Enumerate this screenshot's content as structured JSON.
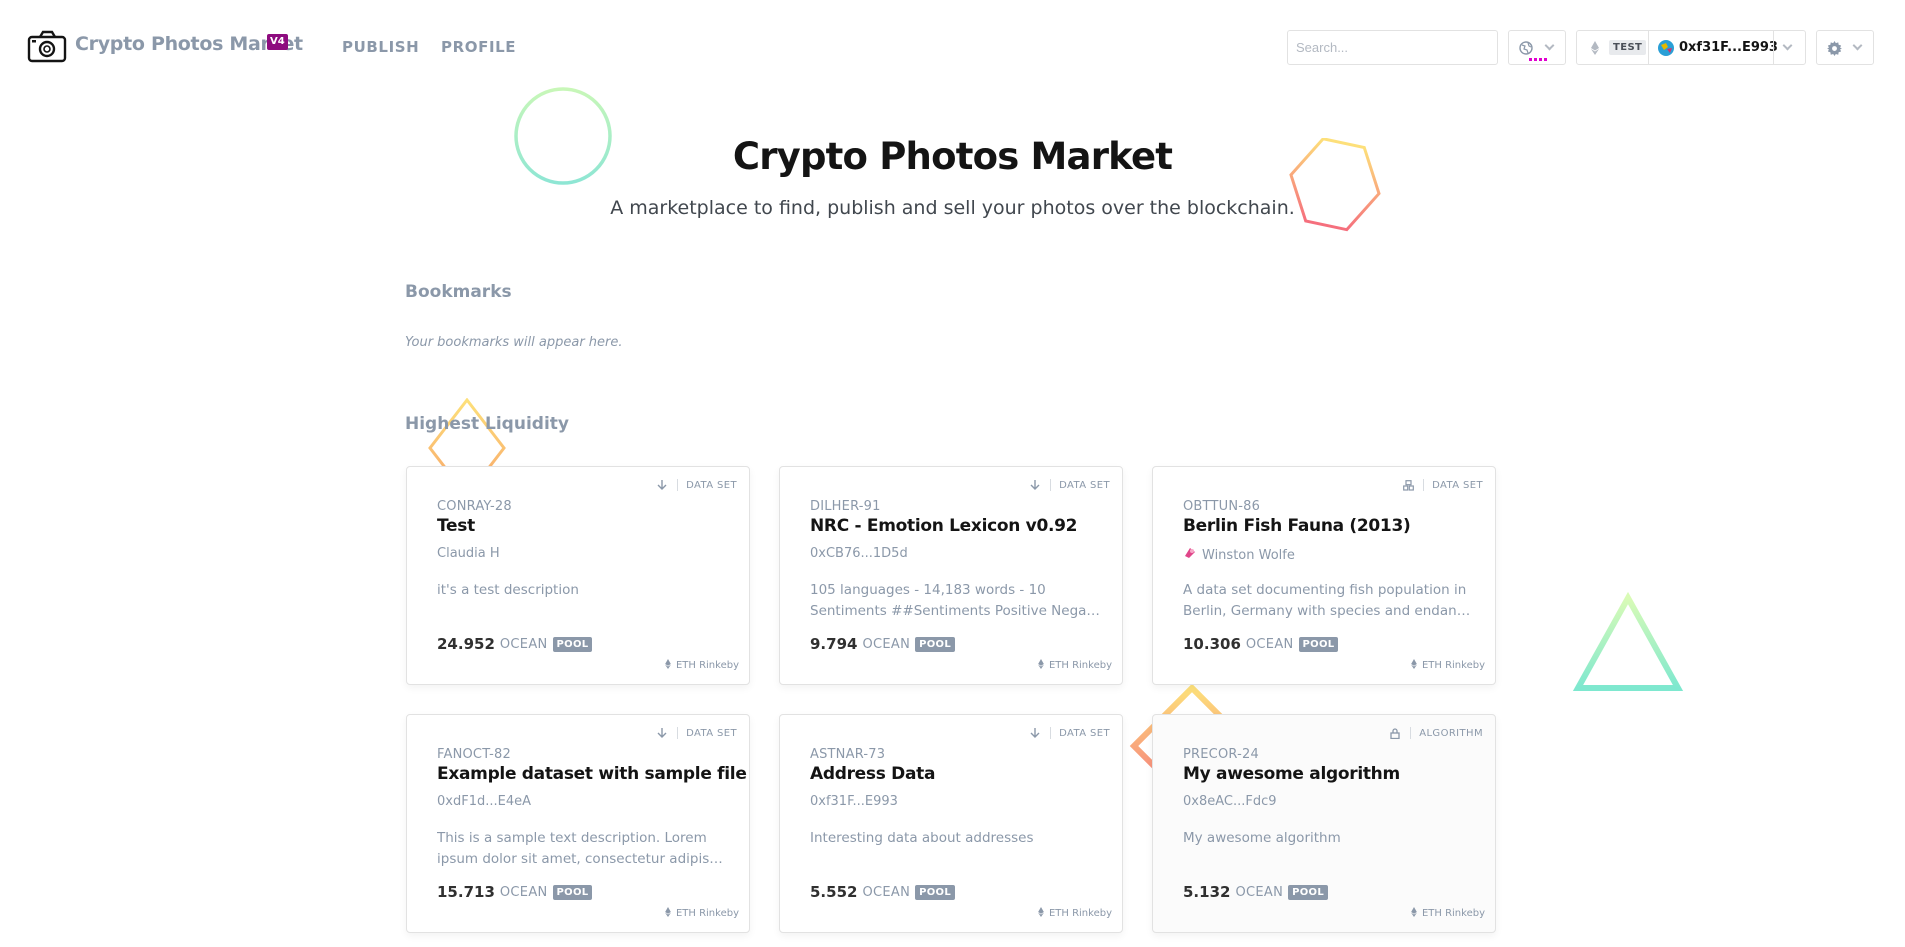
{
  "header": {
    "brand": "Crypto Photos Market",
    "version_badge": "V4",
    "nav": {
      "publish": "PUBLISH",
      "profile": "PROFILE"
    },
    "search": {
      "placeholder": "Search...",
      "value": ""
    },
    "wallet": {
      "network_label": "TEST",
      "address": "0xf31F...E993"
    }
  },
  "hero": {
    "title": "Crypto Photos Market",
    "subtitle": "A marketplace to find, publish and sell your photos over the blockchain."
  },
  "bookmarks": {
    "title": "Bookmarks",
    "empty_text": "Your bookmarks will appear here."
  },
  "highest_liquidity": {
    "title": "Highest Liquidity",
    "cards": [
      {
        "type": "DATA SET",
        "type_icon": "download-icon",
        "symbol": "CONRAY-28",
        "title": "Test",
        "owner": "Claudia H",
        "desc_lines": [
          "it's a test description"
        ],
        "price": "24.952",
        "currency": "OCEAN",
        "pool_badge": "POOL",
        "network": "ETH Rinkeby"
      },
      {
        "type": "DATA SET",
        "type_icon": "download-icon",
        "symbol": "DILHER-91",
        "title": "NRC - Emotion Lexicon v0.92",
        "owner": "0xCB76...1D5d",
        "desc_lines": [
          "105 languages - 14,183 words - 10",
          "Sentiments ##Sentiments Positive Negati..."
        ],
        "price": "9.794",
        "currency": "OCEAN",
        "pool_badge": "POOL",
        "network": "ETH Rinkeby"
      },
      {
        "type": "DATA SET",
        "type_icon": "compute-icon",
        "symbol": "OBTTUN-86",
        "title": "Berlin Fish Fauna (2013)",
        "owner": "Winston Wolfe",
        "desc_lines": [
          "A data set documenting fish population in",
          "Berlin, Germany with species and endang..."
        ],
        "price": "10.306",
        "currency": "OCEAN",
        "pool_badge": "POOL",
        "network": "ETH Rinkeby"
      },
      {
        "type": "DATA SET",
        "type_icon": "download-icon",
        "symbol": "FANOCT-82",
        "title": "Example dataset with sample file",
        "owner": "0xdF1d...E4eA",
        "desc_lines": [
          "This is a sample text description. Lorem",
          "ipsum dolor sit amet, consectetur adipisci..."
        ],
        "price": "15.713",
        "currency": "OCEAN",
        "pool_badge": "POOL",
        "network": "ETH Rinkeby"
      },
      {
        "type": "DATA SET",
        "type_icon": "download-icon",
        "symbol": "ASTNAR-73",
        "title": "Address Data",
        "owner": "0xf31F...E993",
        "desc_lines": [
          "Interesting data about addresses"
        ],
        "price": "5.552",
        "currency": "OCEAN",
        "pool_badge": "POOL",
        "network": "ETH Rinkeby"
      },
      {
        "type": "ALGORITHM",
        "type_icon": "lock-icon",
        "symbol": "PRECOR-24",
        "title": "My awesome algorithm",
        "owner": "0x8eAC...Fdc9",
        "desc_lines": [
          "My awesome algorithm"
        ],
        "price": "5.132",
        "currency": "OCEAN",
        "pool_badge": "POOL",
        "network": "ETH Rinkeby"
      }
    ]
  },
  "colors": {
    "brand_text": "#8b98a9",
    "version_badge_bg": "#8e0c7f",
    "title_text": "#141414",
    "muted_text": "#8b98a9",
    "network_dots": "#e000cf"
  }
}
